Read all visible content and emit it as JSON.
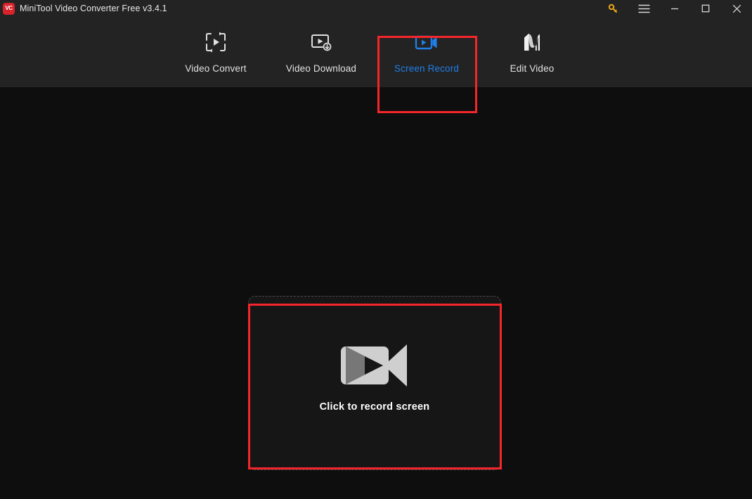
{
  "window": {
    "logo_text": "VC",
    "title": "MiniTool Video Converter Free v3.4.1",
    "controls": {
      "key": "key-icon",
      "menu": "hamburger-menu-icon",
      "minimize": "minimize-icon",
      "maximize": "maximize-icon",
      "close": "close-icon"
    }
  },
  "nav": {
    "items": [
      {
        "label": "Video Convert",
        "icon": "video-convert-icon",
        "active": false
      },
      {
        "label": "Video Download",
        "icon": "video-download-icon",
        "active": false
      },
      {
        "label": "Screen Record",
        "icon": "screen-record-icon",
        "active": true
      },
      {
        "label": "Edit Video",
        "icon": "edit-video-icon",
        "active": false
      }
    ]
  },
  "main": {
    "dropzone": {
      "label": "Click to record screen",
      "icon": "camcorder-icon"
    }
  },
  "colors": {
    "titlebar_bg": "#232323",
    "header_bg": "#232323",
    "page_bg": "#0e0e0e",
    "dropzone_bg": "#161616",
    "accent_blue": "#1f7fe8",
    "highlight_red": "#f4262c",
    "logo_red": "#d8232a",
    "key_gold": "#e8a317",
    "icon_grey": "#d0d0d0"
  }
}
